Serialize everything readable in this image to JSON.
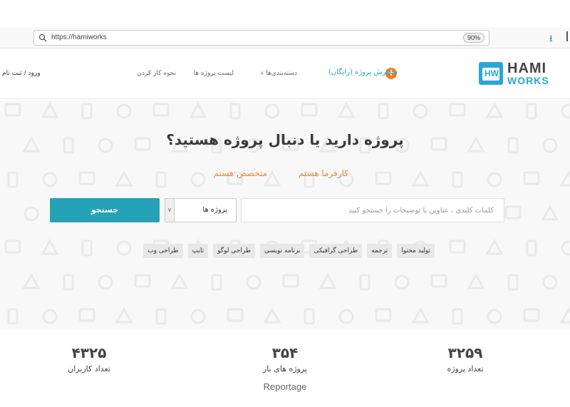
{
  "browser": {
    "url": "https://hamiworks",
    "zoom": "90%",
    "icons": {
      "search": "search-icon",
      "download": "download-icon"
    }
  },
  "header": {
    "logo": {
      "hami": "HAMI",
      "works": "WORKS"
    },
    "order_project": "سفارش پروژه (رایگان)",
    "nav": {
      "categories": "دسته‌بندی‌ها",
      "project_list": "لیست پروژه ها",
      "how_it_works": "نحوه کار کردن"
    },
    "login": "ورود / ثبت نام"
  },
  "hero": {
    "title": "پروژه دارید یا دنبال پروژه هستید؟",
    "employer_link": "کارفرما هستم",
    "expert_link": "متخصص هستم",
    "search": {
      "placeholder": "کلمات کلیدی ، عناوین یا توضیحات را جستجو کنید",
      "type_value": "پروژه ها",
      "button": "جستجو"
    },
    "tags": [
      "تولید محتوا",
      "ترجمه",
      "طراحی گرافیکی",
      "برنامه نویسی",
      "طراحی لوگو",
      "تایپ",
      "طراحی وب"
    ]
  },
  "stats": [
    {
      "value": "۳۲۵۹",
      "label": "تعداد پروژه"
    },
    {
      "value": "۳۵۴",
      "label": "پروژه های باز"
    },
    {
      "value": "۴۳۲۵",
      "label": "تعداد کاربران"
    }
  ],
  "caption": "Reportage",
  "colors": {
    "accent": "#26a2b7",
    "orange": "#f47c20",
    "link_orange": "#f08a3a"
  }
}
